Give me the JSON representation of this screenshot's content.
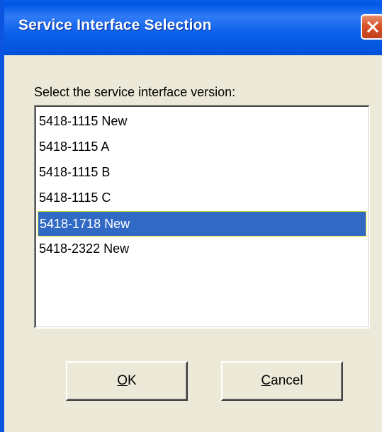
{
  "window": {
    "title": "Service Interface Selection",
    "close_icon": "close-icon"
  },
  "prompt": "Select the service interface version:",
  "list": {
    "items": [
      "5418-1115 New",
      "5418-1115 A",
      "5418-1115 B",
      "5418-1115 C",
      "5418-1718 New",
      "5418-2322 New"
    ],
    "selected": "5418-1718 New"
  },
  "buttons": {
    "ok_mnemonic": "O",
    "ok_rest": "K",
    "cancel_mnemonic": "C",
    "cancel_rest": "ancel"
  },
  "colors": {
    "titlebar": "#0058e6",
    "selection": "#316ac5",
    "window_bg": "#ece9d8"
  }
}
